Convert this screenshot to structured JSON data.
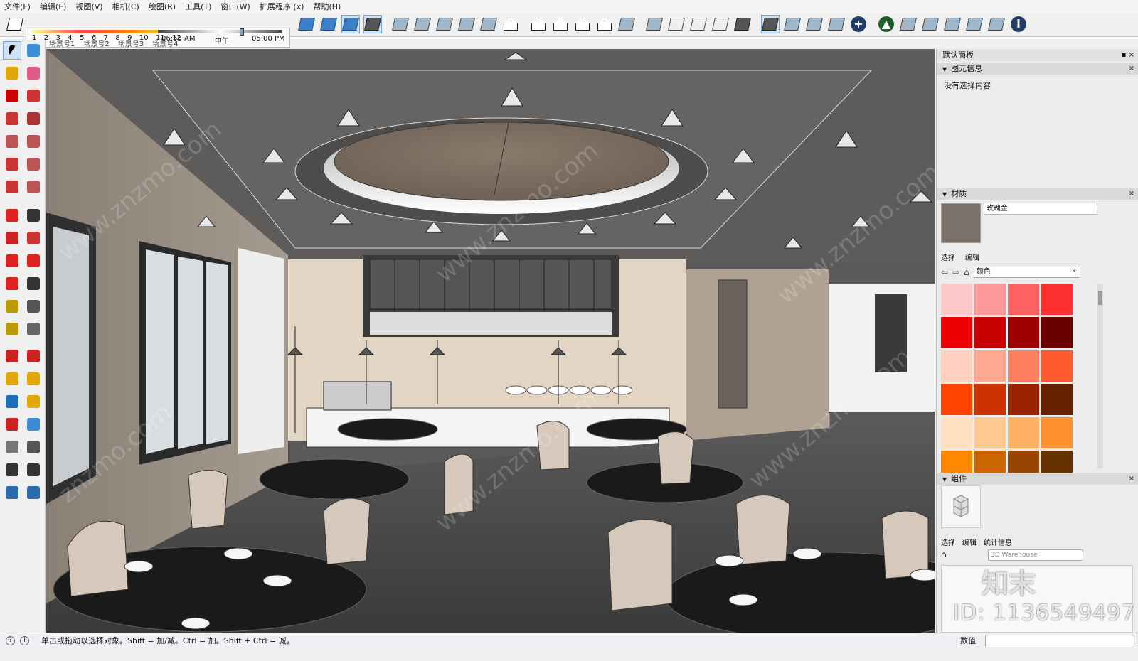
{
  "menu": [
    "文件(F)",
    "编辑(E)",
    "视图(V)",
    "相机(C)",
    "绘图(R)",
    "工具(T)",
    "窗口(W)",
    "扩展程序 (x)",
    "帮助(H)"
  ],
  "shadow": {
    "months": [
      "1",
      "2",
      "3",
      "4",
      "5",
      "6",
      "7",
      "8",
      "9",
      "10",
      "11",
      "12"
    ],
    "time_start": "06:55 AM",
    "noon": "中午",
    "time_end": "05:00 PM"
  },
  "scenes": [
    "场景号1",
    "场景号2",
    "场景号3",
    "场景号4"
  ],
  "panel": {
    "title": "默认面板",
    "entity_info": {
      "title": "图元信息",
      "text": "没有选择内容"
    },
    "materials": {
      "title": "材质",
      "name": "玫瑰金",
      "tab_select": "选择",
      "tab_edit": "编辑",
      "category": "颜色",
      "swatch_color": "#7a7269",
      "palette": [
        "#ffc8c8",
        "#ff9898",
        "#ff6060",
        "#ff3030",
        "#ee0000",
        "#c80000",
        "#a00000",
        "#6a0000",
        "#ffd0c0",
        "#ffa890",
        "#ff8060",
        "#ff5a30",
        "#ff4400",
        "#cc3300",
        "#992200",
        "#662200",
        "#ffe0c0",
        "#ffc890",
        "#ffb060",
        "#ff9030",
        "#ff8800",
        "#cc6600",
        "#994400",
        "#663300"
      ]
    },
    "components": {
      "title": "组件",
      "tab_select": "选择",
      "tab_edit": "编辑",
      "tab_stats": "统计信息",
      "search_placeholder": "3D Warehouse"
    }
  },
  "status": {
    "hint": "单击或拖动以选择对象。Shift = 加/减。Ctrl = 加。Shift + Ctrl = 减。",
    "value_label": "数值"
  },
  "watermark": {
    "id": "ID: 1136549497",
    "brand": "知末"
  },
  "icons": {
    "toolbar": [
      "eraser-icon",
      "orbit-icon",
      "iso-view-icon",
      "iso-view-icon",
      "xray-icon",
      "wireframe-icon",
      "hidden-line-icon",
      "shaded-icon",
      "textured-icon",
      "monochrome-icon",
      "house-front-icon",
      "house-left-icon",
      "house-home-icon",
      "house-right-icon",
      "house-back-icon",
      "section-plane-icon",
      "section-display-icon",
      "face-icon",
      "face-icon",
      "face-icon",
      "layers-icon",
      "layers-icon",
      "extension-e-icon",
      "refresh-icon",
      "swap-icon",
      "plus-icon",
      "tree-icon",
      "sunset-icon",
      "checker-icon",
      "cloud-upload-icon",
      "gears-icon",
      "mail-icon",
      "info-icon"
    ]
  }
}
